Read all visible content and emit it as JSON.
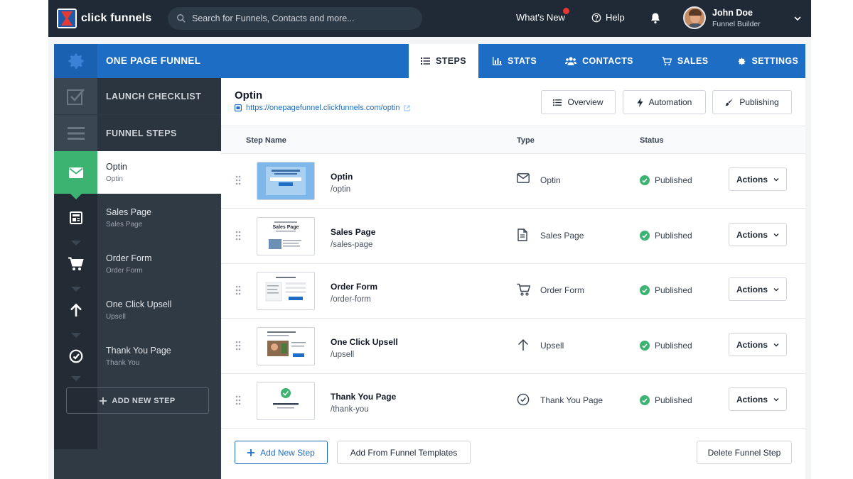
{
  "topbar": {
    "brand": "click funnels",
    "search_placeholder": "Search for Funnels, Contacts and more...",
    "whats_new": "What's New",
    "whats_new_badge": "",
    "help": "Help",
    "user_name": "John Doe",
    "user_role": "Funnel Builder"
  },
  "funnel": {
    "title": "ONE PAGE FUNNEL",
    "tabs": [
      {
        "label": "STEPS",
        "icon": "list-icon",
        "active": true
      },
      {
        "label": "STATS",
        "icon": "bar-chart-icon",
        "active": false
      },
      {
        "label": "CONTACTS",
        "icon": "users-icon",
        "active": false
      },
      {
        "label": "SALES",
        "icon": "cart-icon",
        "active": false
      },
      {
        "label": "SETTINGS",
        "icon": "gear-icon",
        "active": false
      }
    ]
  },
  "sidebar": {
    "launch_checklist": "LAUNCH CHECKLIST",
    "funnel_steps": "FUNNEL STEPS",
    "steps": [
      {
        "name": "Optin",
        "sub": "Optin",
        "icon": "mail-icon",
        "active": true
      },
      {
        "name": "Sales Page",
        "sub": "Sales Page",
        "icon": "page-icon",
        "active": false
      },
      {
        "name": "Order Form",
        "sub": "Order Form",
        "icon": "cart-icon",
        "active": false
      },
      {
        "name": "One Click Upsell",
        "sub": "Upsell",
        "icon": "arrow-up-icon",
        "active": false
      },
      {
        "name": "Thank You Page",
        "sub": "Thank You",
        "icon": "check-circle-icon",
        "active": false
      }
    ],
    "add_new_step": "ADD NEW STEP"
  },
  "main": {
    "title": "Optin",
    "url": "https://onepagefunnel.clickfunnels.com/optin",
    "buttons": {
      "overview": "Overview",
      "automation": "Automation",
      "publishing": "Publishing"
    },
    "columns": {
      "name": "Step Name",
      "type": "Type",
      "status": "Status"
    },
    "rows": [
      {
        "name": "Optin",
        "path": "/optin",
        "type": "Optin",
        "type_icon": "mail-icon",
        "status": "Published",
        "action": "Actions"
      },
      {
        "name": "Sales Page",
        "path": "/sales-page",
        "type": "Sales Page",
        "type_icon": "document-icon",
        "status": "Published",
        "action": "Actions"
      },
      {
        "name": "Order Form",
        "path": "/order-form",
        "type": "Order Form",
        "type_icon": "cart-icon",
        "status": "Published",
        "action": "Actions"
      },
      {
        "name": "One Click Upsell",
        "path": "/upsell",
        "type": "Upsell",
        "type_icon": "arrow-up-icon",
        "status": "Published",
        "action": "Actions"
      },
      {
        "name": "Thank You Page",
        "path": "/thank-you",
        "type": "Thank You Page",
        "type_icon": "check-circle-icon",
        "status": "Published",
        "action": "Actions"
      }
    ],
    "thumb_text": {
      "sales": "Sales Page"
    },
    "footer": {
      "add_new_step": "Add New Step",
      "add_from_templates": "Add From Funnel Templates",
      "delete": "Delete Funnel Step"
    }
  },
  "colors": {
    "topbar": "#1f2a36",
    "brand_blue": "#1e6dc4",
    "sidebar": "#2f3a45",
    "success": "#3cb371"
  }
}
